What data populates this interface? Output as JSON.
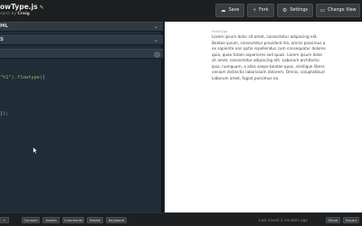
{
  "header": {
    "title": "owType.js",
    "byline_prefix": "oject by",
    "author": "Craig",
    "buttons": {
      "save": "Save",
      "fork": "Fork",
      "settings": "Settings",
      "change_view": "Change View"
    }
  },
  "editors": {
    "html_label": "ML",
    "css_label": "S",
    "js_label": ""
  },
  "code": {
    "line1_prefix": "\"h1\").flowtype({",
    "line2": "",
    "line3": "});"
  },
  "result": {
    "heading": "FlowType",
    "paragraph": "Lorem ipsum dolor sit amet, consectetur adipiscing elit. Beatae ipsum, consectetur provident illo, omnis possimus a ex sapiente non optio repellendus cum consequatur dolores quia, quae totam asperiores sed quasi. Lorem ipsum dolor sit amet, consectetur adipiscing elit. Laborum architecto ipsa, numquam, a alias saepe beatae quos, similique libero veniam distinctio laboriosam dolorem. Omnis, voluptatibus! Laborum amet, fugiat possimus ea."
  },
  "footer": {
    "buttons": [
      "Console",
      "Assets",
      "Comments",
      "Delete",
      "Keyboard"
    ],
    "saved_text": "Last saved 2 minutes ago",
    "share": "Share",
    "export": "Export",
    "left_stub": "t"
  }
}
